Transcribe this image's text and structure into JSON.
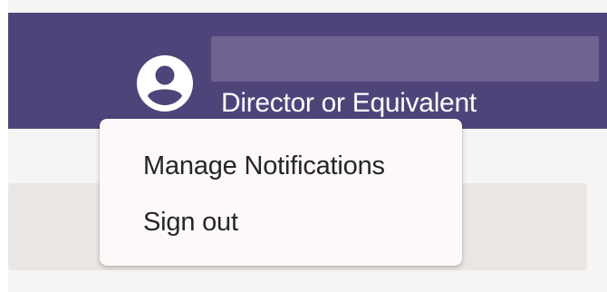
{
  "header": {
    "user_role": "Director or Equivalent",
    "avatar_icon": "user-circle-icon",
    "background_color": "#4f447a"
  },
  "dropdown": {
    "items": [
      {
        "label": "Manage Notifications"
      },
      {
        "label": "Sign out"
      }
    ]
  }
}
